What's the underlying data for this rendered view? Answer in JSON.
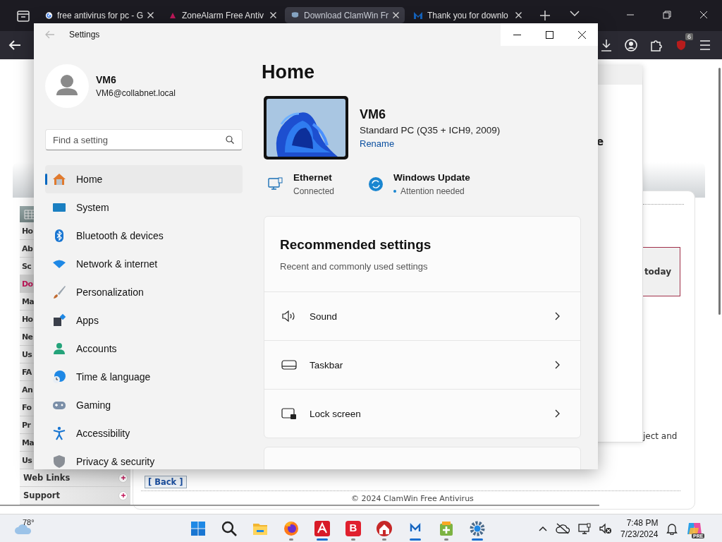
{
  "browser": {
    "tabs": [
      {
        "label": "free antivirus for pc - G",
        "selected": false
      },
      {
        "label": "ZoneAlarm Free Antiv",
        "selected": false
      },
      {
        "label": "Download ClamWin Fr",
        "selected": true
      },
      {
        "label": "Thank you for downlo",
        "selected": false
      }
    ],
    "extension_badge": "6",
    "page": {
      "sidebar": [
        {
          "label": "Ho",
          "selected": false,
          "expand_icon": false
        },
        {
          "label": "Ab",
          "selected": false,
          "expand_icon": false
        },
        {
          "label": "Sc",
          "selected": false,
          "expand_icon": false
        },
        {
          "label": "Do",
          "selected": true,
          "expand_icon": false
        },
        {
          "label": "Ma",
          "selected": false,
          "expand_icon": false
        },
        {
          "label": "Ho",
          "selected": false,
          "expand_icon": false
        },
        {
          "label": "Ne",
          "selected": false,
          "expand_icon": false
        },
        {
          "label": "Us",
          "selected": false,
          "expand_icon": false
        },
        {
          "label": "FA",
          "selected": false,
          "expand_icon": false
        },
        {
          "label": "An",
          "selected": false,
          "expand_icon": false
        },
        {
          "label": "Fo",
          "selected": false,
          "expand_icon": false
        },
        {
          "label": "Pr",
          "selected": false,
          "expand_icon": false
        },
        {
          "label": "Ma",
          "selected": false,
          "expand_icon": false
        },
        {
          "label": "Us",
          "selected": false,
          "expand_icon": false
        },
        {
          "label": "Web Links",
          "selected": false,
          "expand_icon": true
        },
        {
          "label": "Support",
          "selected": false,
          "expand_icon": true
        }
      ],
      "heading_fragment": "e",
      "button_fragment": "today",
      "text_fragment": "ject and",
      "back_link": "[ Back ]",
      "footer": "© 2024 ClamWin Free Antivirus"
    }
  },
  "settings": {
    "title": "Settings",
    "user": {
      "name": "VM6",
      "email": "VM6@collabnet.local"
    },
    "search": {
      "placeholder": "Find a setting"
    },
    "nav": [
      {
        "label": "Home",
        "selected": true
      },
      {
        "label": "System",
        "selected": false
      },
      {
        "label": "Bluetooth & devices",
        "selected": false
      },
      {
        "label": "Network & internet",
        "selected": false
      },
      {
        "label": "Personalization",
        "selected": false
      },
      {
        "label": "Apps",
        "selected": false
      },
      {
        "label": "Accounts",
        "selected": false
      },
      {
        "label": "Time & language",
        "selected": false
      },
      {
        "label": "Gaming",
        "selected": false
      },
      {
        "label": "Accessibility",
        "selected": false
      },
      {
        "label": "Privacy & security",
        "selected": false
      }
    ],
    "heading": "Home",
    "device": {
      "name": "VM6",
      "model": "Standard PC (Q35 + ICH9, 2009)",
      "action": "Rename"
    },
    "status": [
      {
        "title": "Ethernet",
        "detail": "Connected",
        "alert": false
      },
      {
        "title": "Windows Update",
        "detail": "Attention needed",
        "alert": true
      }
    ],
    "recommended": {
      "title": "Recommended settings",
      "subtitle": "Recent and commonly used settings",
      "rows": [
        {
          "label": "Sound"
        },
        {
          "label": "Taskbar"
        },
        {
          "label": "Lock screen"
        }
      ]
    }
  },
  "taskbar": {
    "weather": "78°",
    "apps": [
      {
        "running": false,
        "active": false
      },
      {
        "running": false,
        "active": false
      },
      {
        "running": false,
        "active": false
      },
      {
        "running": true,
        "active": false
      },
      {
        "running": true,
        "active": true
      },
      {
        "running": true,
        "active": false,
        "label": "B"
      },
      {
        "running": true,
        "active": false
      },
      {
        "running": true,
        "active": true
      },
      {
        "running": true,
        "active": false
      },
      {
        "running": true,
        "active": true
      }
    ],
    "time": "7:48 PM",
    "date": "7/23/2024",
    "copilot_badge": "PRE"
  }
}
